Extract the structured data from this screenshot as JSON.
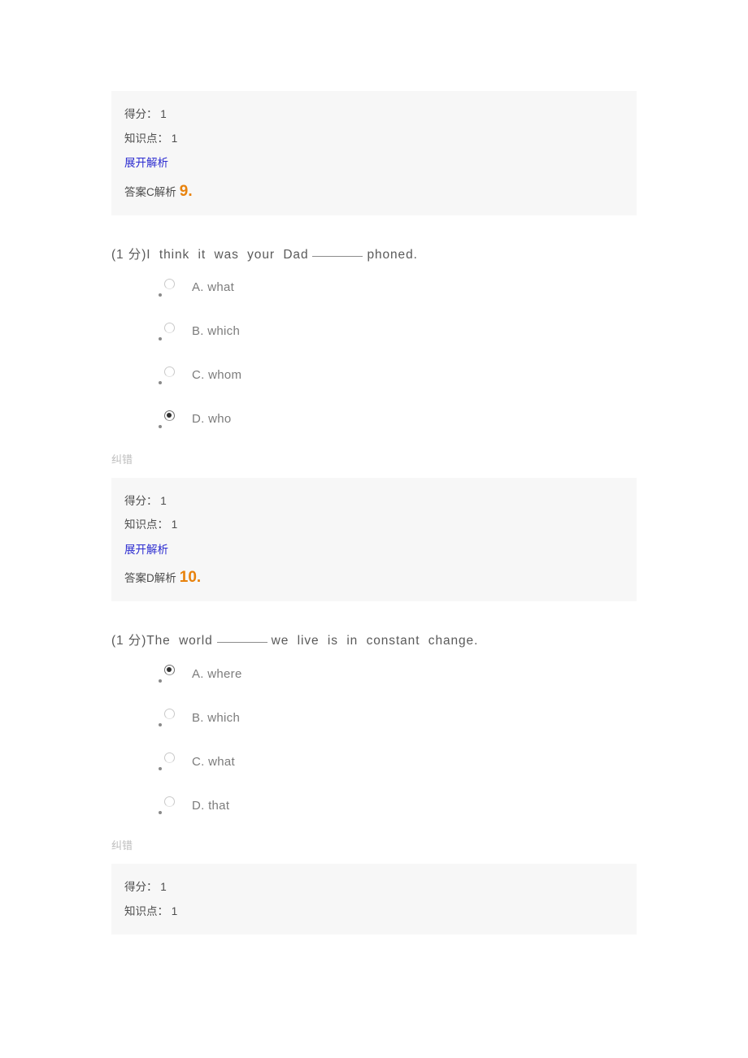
{
  "labels": {
    "score": "得分：",
    "knowledge_point": "知识点：",
    "expand_analysis": "展开解析",
    "answer_prefix": "答案",
    "analysis_prefix": "解析",
    "report_error": "纠错"
  },
  "blocks": [
    {
      "type": "info",
      "score_value": "1",
      "knowledge_value": "1",
      "answer_letter": "C",
      "analysis_number": "9.",
      "truncated": false
    },
    {
      "type": "question",
      "question_text_before": "(1 分)I  think  it  was  your  Dad",
      "question_text_after": "phoned.",
      "options": [
        {
          "label": "A. what",
          "selected": false
        },
        {
          "label": "B. which",
          "selected": false
        },
        {
          "label": "C. whom",
          "selected": false
        },
        {
          "label": "D. who",
          "selected": true
        }
      ]
    },
    {
      "type": "info",
      "score_value": "1",
      "knowledge_value": "1",
      "answer_letter": "D",
      "analysis_number": "10.",
      "truncated": false
    },
    {
      "type": "question",
      "question_text_before": "(1 分)The  world",
      "question_text_after": "we  live  is  in  constant  change.",
      "options": [
        {
          "label": "A. where",
          "selected": true
        },
        {
          "label": "B. which",
          "selected": false
        },
        {
          "label": "C. what",
          "selected": false
        },
        {
          "label": "D. that",
          "selected": true
        }
      ]
    },
    {
      "type": "info",
      "score_value": "1",
      "knowledge_value": "1",
      "answer_letter": "",
      "analysis_number": "",
      "truncated": true
    }
  ],
  "colors": {
    "panel_background": "#f7f7f7",
    "link_blue": "#2b2bd0",
    "accent_orange": "#e8820c",
    "text_gray": "#5a5a5a",
    "muted_gray": "#bdbdbd"
  }
}
